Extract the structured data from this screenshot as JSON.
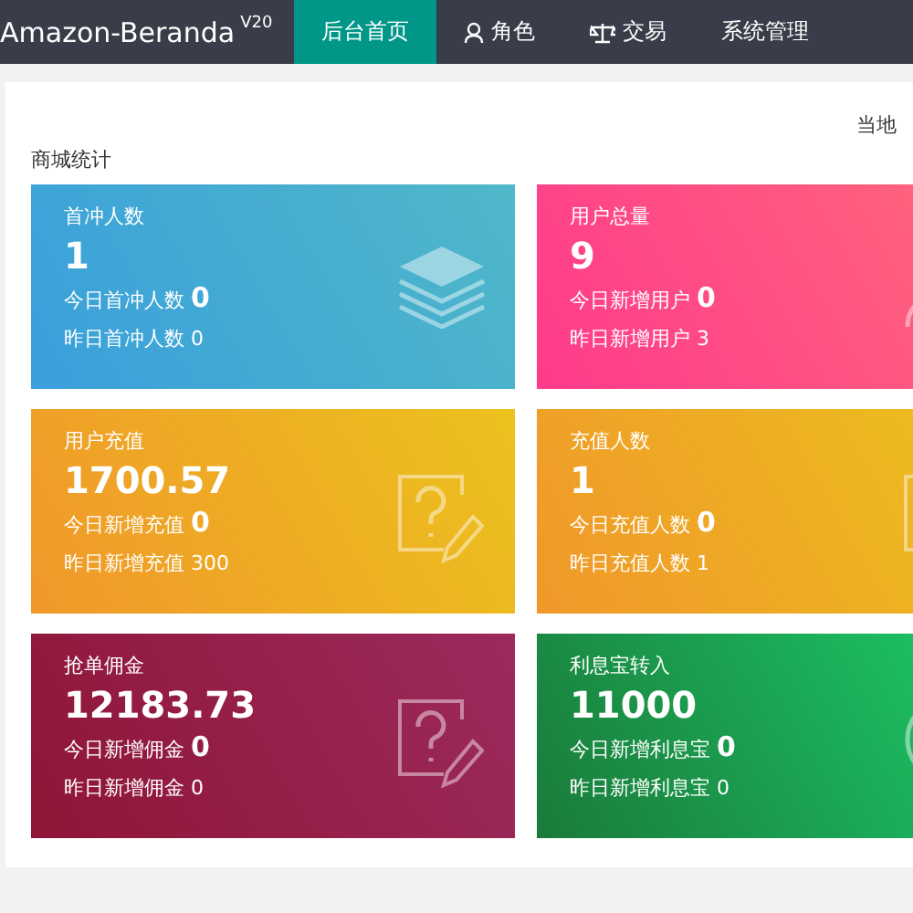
{
  "nav": {
    "brand": "Amazon-Beranda",
    "version": "V20",
    "tabs": [
      {
        "label": "后台首页",
        "kind": "plain",
        "selected": true
      },
      {
        "label": "角色",
        "kind": "person",
        "selected": false
      },
      {
        "label": "交易",
        "kind": "scale",
        "selected": false
      },
      {
        "label": "系统管理",
        "kind": "plain",
        "selected": false
      }
    ]
  },
  "panel": {
    "local_time_label": "当地",
    "title": "商城统计",
    "cards": [
      {
        "title": "首冲人数",
        "value": "1",
        "today_label": "今日首冲人数",
        "today_value": "0",
        "yesterday": "昨日首冲人数 0",
        "kind": "layers",
        "color": "#3a9fdc"
      },
      {
        "title": "用户总量",
        "value": "9",
        "today_label": "今日新增用户",
        "today_value": "0",
        "yesterday": "昨日新增用户 3",
        "kind": "person",
        "color": "#ff3a8c"
      },
      {
        "title": "用户充值",
        "value": "1700.57",
        "today_label": "今日新增充值",
        "today_value": "0",
        "yesterday": "昨日新增充值 300",
        "kind": "edit",
        "color": "#f0982a"
      },
      {
        "title": "充值人数",
        "value": "1",
        "today_label": "今日充值人数",
        "today_value": "0",
        "yesterday": "昨日充值人数 1",
        "kind": "edit",
        "color": "#f0982a"
      },
      {
        "title": "抢单佣金",
        "value": "12183.73",
        "today_label": "今日新增佣金",
        "today_value": "0",
        "yesterday": "昨日新增佣金 0",
        "kind": "edit",
        "color": "#8f1536"
      },
      {
        "title": "利息宝转入",
        "value": "11000",
        "today_label": "今日新增利息宝",
        "today_value": "0",
        "yesterday": "昨日新增利息宝 0",
        "kind": "circle",
        "color": "#1a7a3a"
      }
    ]
  }
}
